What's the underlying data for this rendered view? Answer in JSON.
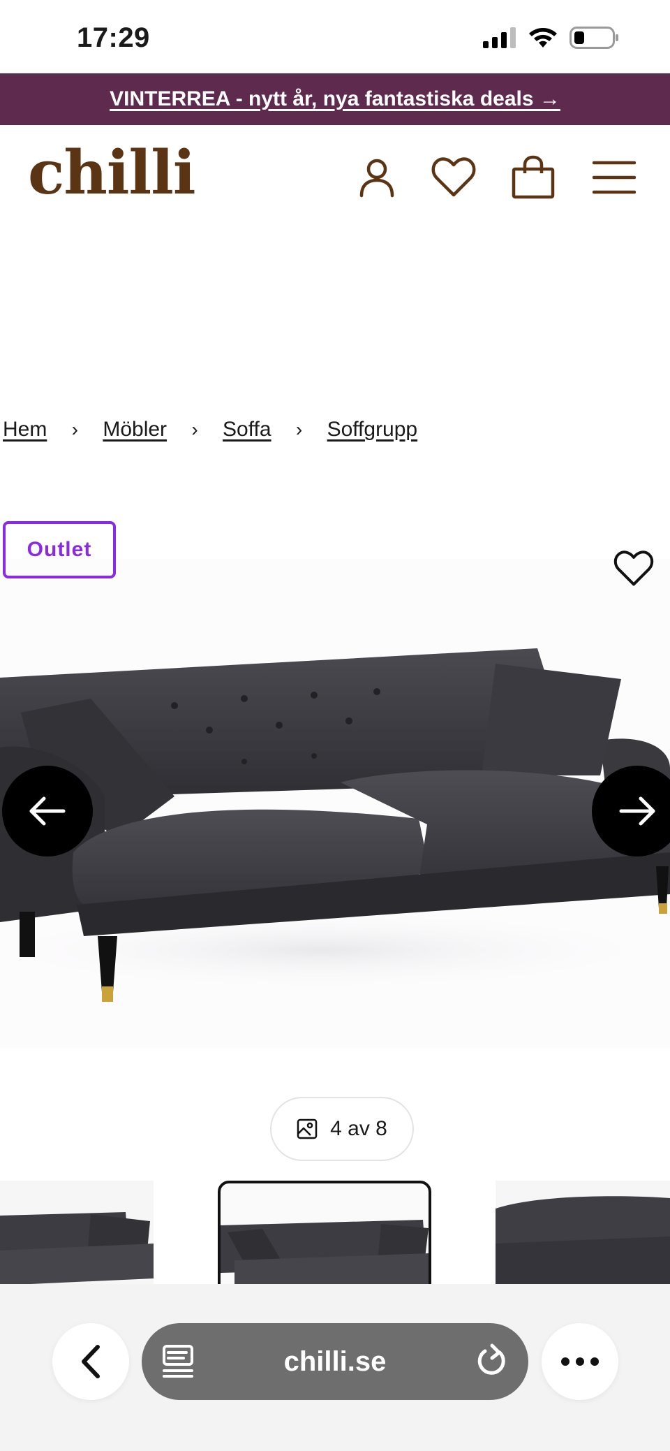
{
  "status_bar": {
    "time": "17:29",
    "icons": [
      "signal-icon",
      "wifi-icon",
      "battery-icon"
    ]
  },
  "promo_banner": {
    "text": "VINTERREA - nytt år, nya fantastiska deals →"
  },
  "header": {
    "logo": "chilli",
    "icons": [
      "account-icon",
      "wishlist-icon",
      "cart-icon",
      "menu-icon"
    ]
  },
  "breadcrumb": {
    "items": [
      "Hem",
      "Möbler",
      "Soffa",
      "Soffgrupp"
    ],
    "separator": "›"
  },
  "product": {
    "badge": "Outlet",
    "image_counter": "4 av 8"
  },
  "browser": {
    "url": "chilli.se"
  },
  "colors": {
    "promo_bg": "#5e2b4e",
    "logo": "#5a3413",
    "outlet": "#8a2be2",
    "url_pill": "#6e6e6e"
  }
}
